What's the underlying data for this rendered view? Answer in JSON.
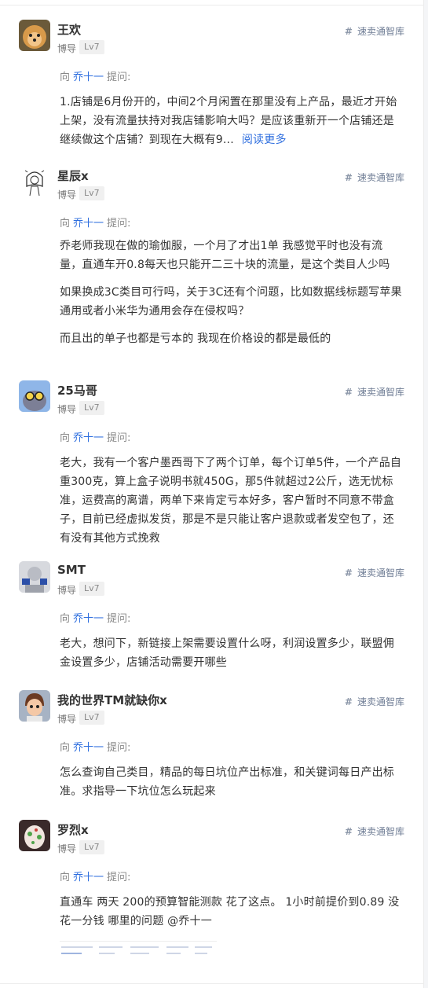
{
  "feed": {
    "posts": [
      {
        "user": "王欢",
        "role": "博导",
        "level": "Lv7",
        "tag": "速卖通智库",
        "ask_prefix": "向",
        "ask_target": "乔十一",
        "ask_suffix": "提问:",
        "paragraphs": [
          "1.店铺是6月份开的，中间2个月闲置在那里没有上产品，最近才开始上架，没有流量扶持对我店铺影响大吗？是应该重新开一个店铺还是继续做这个店铺？到现在大概有9..."
        ],
        "read_more": "阅读更多"
      },
      {
        "user": "星辰x",
        "role": "博导",
        "level": "Lv7",
        "tag": "速卖通智库",
        "ask_prefix": "向",
        "ask_target": "乔十一",
        "ask_suffix": "提问:",
        "paragraphs": [
          "乔老师我现在做的瑜伽服，一个月了才出1单 我感觉平时也没有流量，直通车开0.8每天也只能开二三十块的流量，是这个类目人少吗",
          "如果换成3C类目可行吗，关于3C还有个问题，比如数据线标题写苹果通用或者小米华为通用会存在侵权吗？",
          "而且出的单子也都是亏本的 我现在价格设的都是最低的"
        ]
      },
      {
        "user": "25马哥",
        "role": "博导",
        "level": "Lv7",
        "tag": "速卖通智库",
        "ask_prefix": "向",
        "ask_target": "乔十一",
        "ask_suffix": "提问:",
        "paragraphs": [
          "老大，我有一个客户墨西哥下了两个订单，每个订单5件，一个产品自重300克，算上盒子说明书就450G，那5件就超过2公斤，选无忧标准，运费高的离谱，两单下来肯定亏本好多，客户暂时不同意不带盒子，目前已经虚拟发货，那是不是只能让客户退款或者发空包了，还有没有其他方式挽救"
        ]
      },
      {
        "user": "SMT",
        "role": "博导",
        "level": "Lv7",
        "tag": "速卖通智库",
        "ask_prefix": "向",
        "ask_target": "乔十一",
        "ask_suffix": "提问:",
        "paragraphs": [
          "老大，想问下，新链接上架需要设置什么呀，利润设置多少，联盟佣金设置多少，店铺活动需要开哪些"
        ]
      },
      {
        "user": "我的世界TM就缺你x",
        "role": "博导",
        "level": "Lv7",
        "tag": "速卖通智库",
        "ask_prefix": "向",
        "ask_target": "乔十一",
        "ask_suffix": "提问:",
        "paragraphs": [
          "怎么查询自己类目，精品的每日坑位产出标准，和关键词每日产出标准。求指导一下坑位怎么玩起来"
        ]
      },
      {
        "user": "罗烈x",
        "role": "博导",
        "level": "Lv7",
        "tag": "速卖通智库",
        "ask_prefix": "向",
        "ask_target": "乔十一",
        "ask_suffix": "提问:",
        "paragraphs": [
          "直通车 两天 200的预算智能测款 花了这点。 1小时前提价到0.89 没花一分钱 哪里的问题 @乔十一"
        ]
      }
    ]
  }
}
